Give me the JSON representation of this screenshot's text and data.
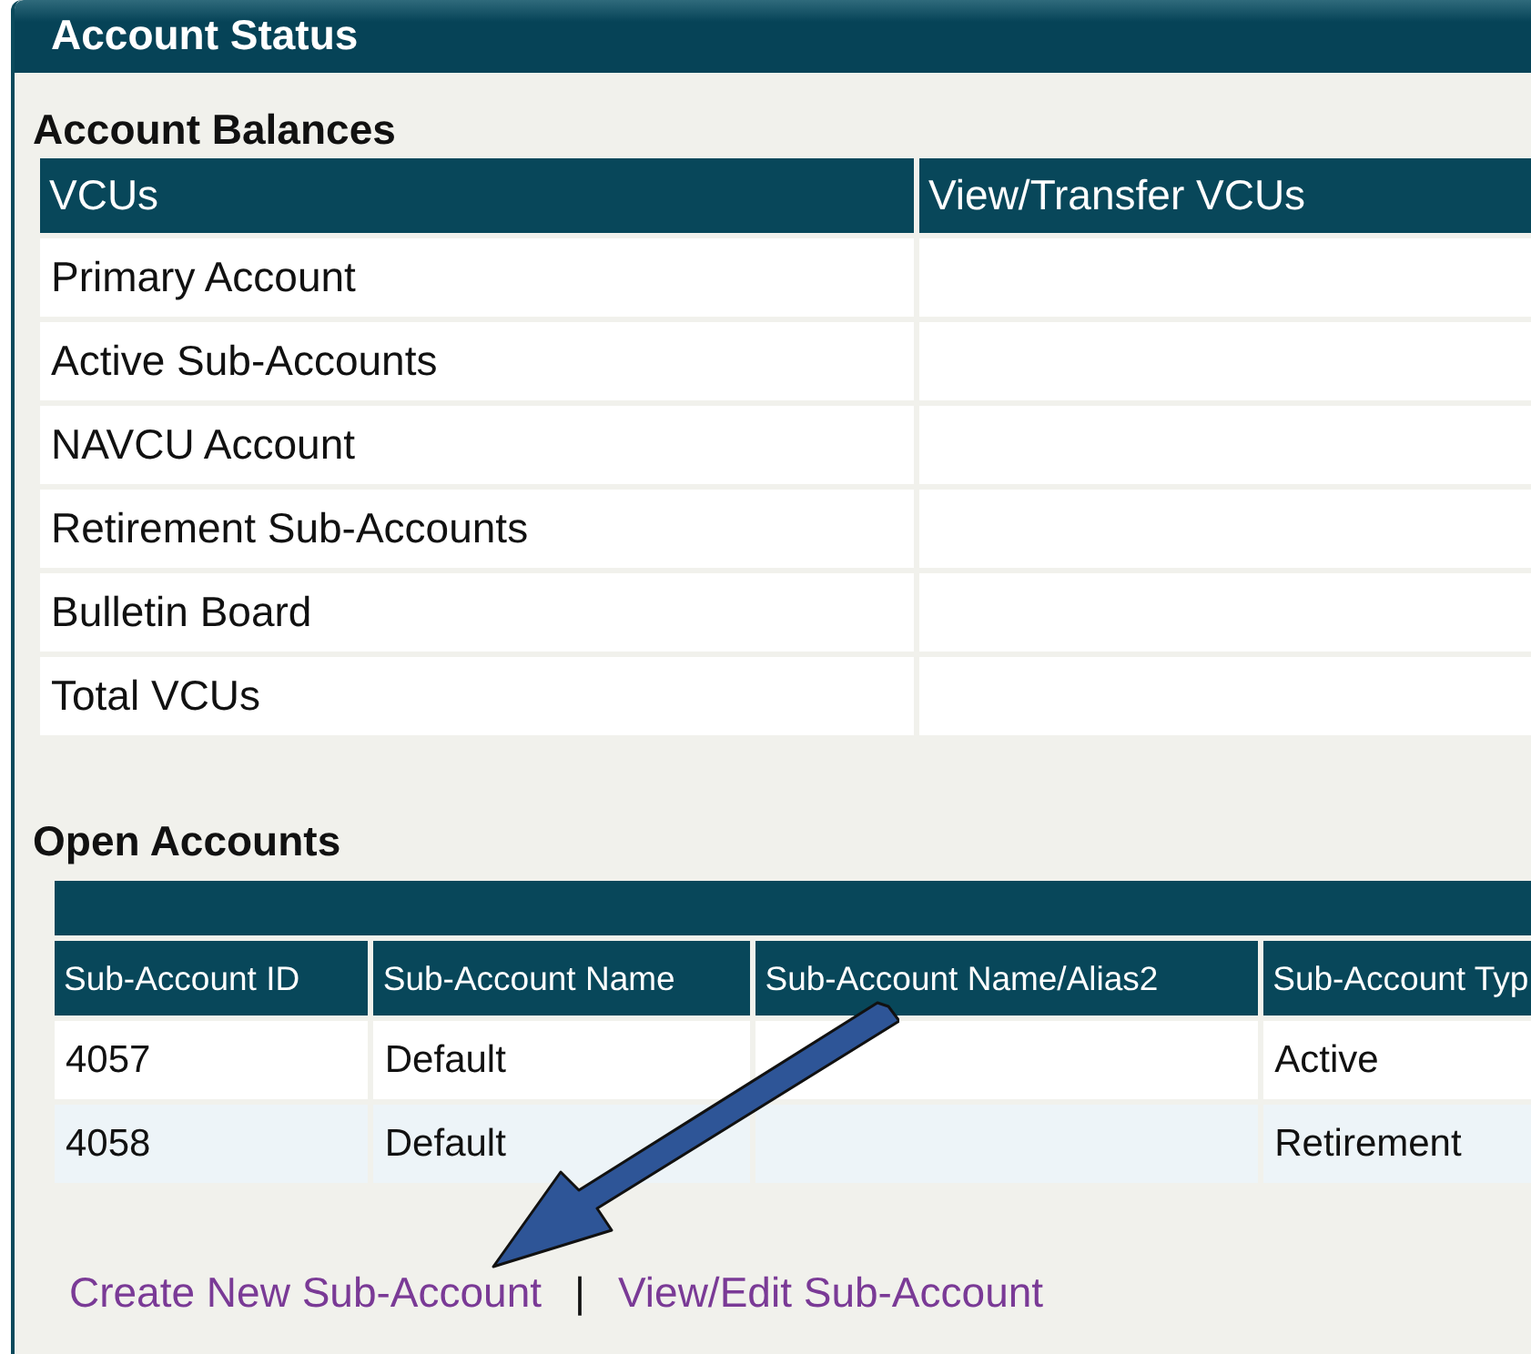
{
  "panel": {
    "title": "Account Status"
  },
  "balances": {
    "heading": "Account Balances",
    "columns": [
      "VCUs",
      "View/Transfer VCUs"
    ],
    "rows": [
      [
        "Primary Account"
      ],
      [
        "Active Sub-Accounts"
      ],
      [
        "NAVCU Account"
      ],
      [
        "Retirement Sub-Accounts"
      ],
      [
        "Bulletin Board"
      ],
      [
        "Total VCUs"
      ]
    ]
  },
  "open_accounts": {
    "heading": "Open Accounts",
    "columns": [
      "Sub-Account ID",
      "Sub-Account Name",
      "Sub-Account Name/Alias2",
      "Sub-Account Typ"
    ],
    "rows": [
      [
        "4057",
        "Default",
        "",
        "Active"
      ],
      [
        "4058",
        "Default",
        "",
        "Retirement"
      ]
    ]
  },
  "links": [
    "Create New Sub-Account",
    "View/Edit Sub-Account"
  ],
  "link_separator": "|"
}
